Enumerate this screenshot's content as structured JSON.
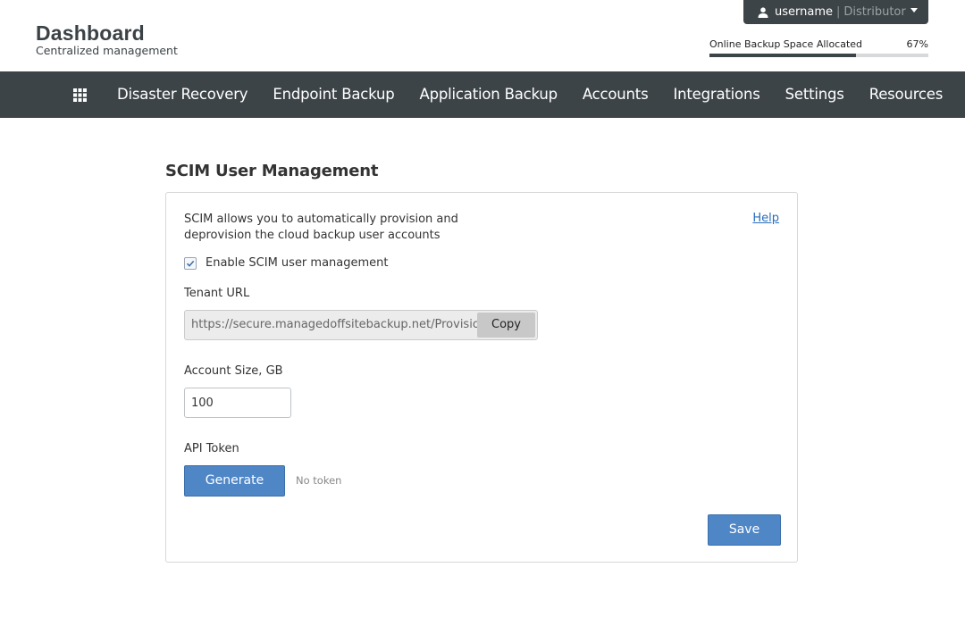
{
  "header": {
    "title": "Dashboard",
    "subtitle": "Centralized management",
    "user": {
      "name": "username",
      "separator": "|",
      "role": "Distributor",
      "icon": "user-icon"
    },
    "backup_space": {
      "label": "Online Backup Space Allocated",
      "percent_label": "67%",
      "percent": 67
    }
  },
  "nav": {
    "grid_icon": "apps-grid-icon",
    "items": [
      {
        "label": "Disaster Recovery"
      },
      {
        "label": "Endpoint Backup"
      },
      {
        "label": "Application Backup"
      },
      {
        "label": "Accounts"
      },
      {
        "label": "Integrations"
      },
      {
        "label": "Settings"
      },
      {
        "label": "Resources"
      }
    ]
  },
  "main": {
    "title": "SCIM User Management",
    "description": "SCIM allows you to automatically provision and deprovision the cloud backup user accounts",
    "help_label": "Help",
    "enable_label": "Enable SCIM user management",
    "enable_checked": true,
    "tenant_url_label": "Tenant URL",
    "tenant_url_value": "https://secure.managedoffsitebackup.net/Provisioning",
    "copy_label": "Copy",
    "account_size_label": "Account Size, GB",
    "account_size_value": "100",
    "api_token_label": "API Token",
    "generate_label": "Generate",
    "token_status": "No token",
    "save_label": "Save"
  },
  "colors": {
    "nav_bg": "#3d4448",
    "primary_button": "#4f86c6",
    "link": "#2a6ebb"
  }
}
